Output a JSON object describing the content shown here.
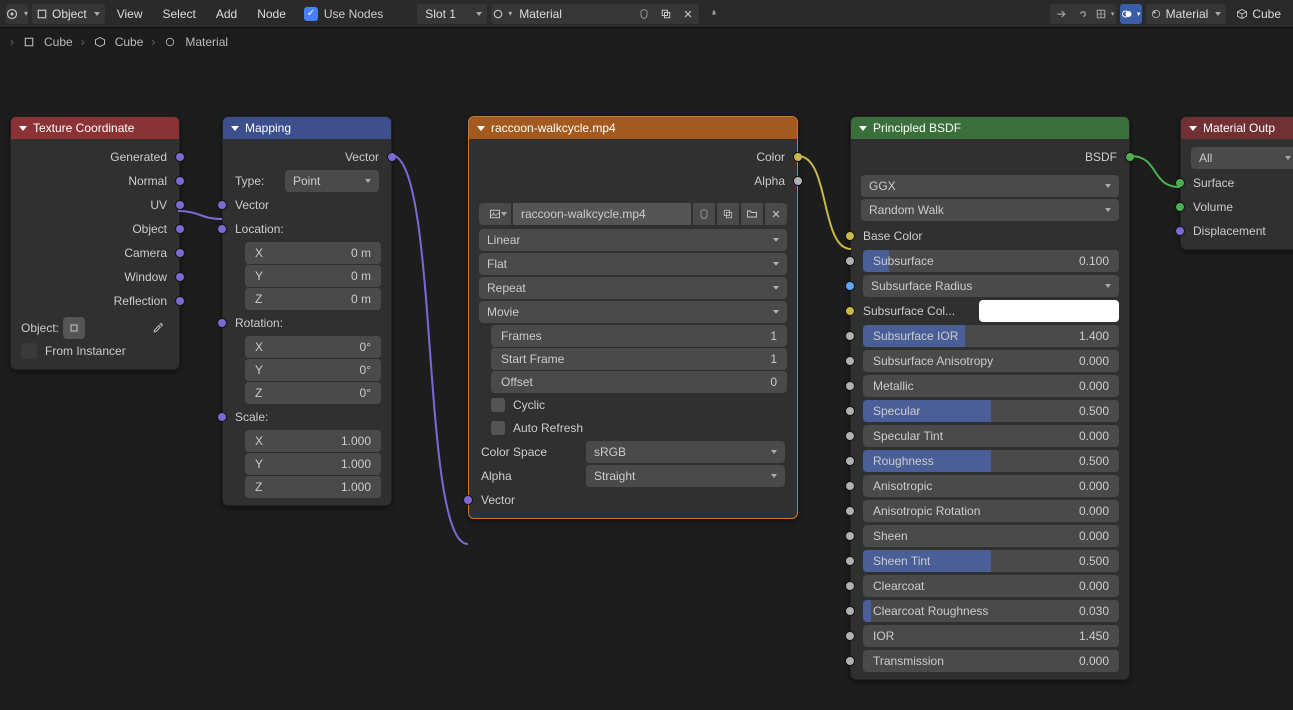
{
  "header": {
    "type_selector": "Object",
    "menu": [
      "View",
      "Select",
      "Add",
      "Node"
    ],
    "use_nodes_label": "Use Nodes",
    "slot": "Slot 1",
    "material_name": "Material",
    "right_material": "Material",
    "object_name": "Cube"
  },
  "breadcrumb": {
    "items": [
      "Cube",
      "Cube",
      "Material"
    ]
  },
  "nodes": {
    "texcoord": {
      "title": "Texture Coordinate",
      "outputs": [
        "Generated",
        "Normal",
        "UV",
        "Object",
        "Camera",
        "Window",
        "Reflection"
      ],
      "object_label": "Object:",
      "from_instancer": "From Instancer"
    },
    "mapping": {
      "title": "Mapping",
      "output_vector": "Vector",
      "type_label": "Type:",
      "type_value": "Point",
      "input_vector": "Vector",
      "location_label": "Location:",
      "loc_x": "0 m",
      "loc_y": "0 m",
      "loc_z": "0 m",
      "rotation_label": "Rotation:",
      "rot_x": "0°",
      "rot_y": "0°",
      "rot_z": "0°",
      "scale_label": "Scale:",
      "sc_x": "1.000",
      "sc_y": "1.000",
      "sc_z": "1.000"
    },
    "image": {
      "title": "raccoon-walkcycle.mp4",
      "out_color": "Color",
      "out_alpha": "Alpha",
      "file": "raccoon-walkcycle.mp4",
      "interp": "Linear",
      "projection": "Flat",
      "extension": "Repeat",
      "source": "Movie",
      "frames_label": "Frames",
      "frames": "1",
      "start_label": "Start Frame",
      "start": "1",
      "offset_label": "Offset",
      "offset": "0",
      "cyclic": "Cyclic",
      "auto_refresh": "Auto Refresh",
      "colorspace_label": "Color Space",
      "colorspace": "sRGB",
      "alpha_label": "Alpha",
      "alpha_mode": "Straight",
      "in_vector": "Vector"
    },
    "bsdf": {
      "title": "Principled BSDF",
      "out_bsdf": "BSDF",
      "distribution": "GGX",
      "subsurface_method": "Random Walk",
      "base_color_label": "Base Color",
      "sliders": [
        {
          "name": "Subsurface",
          "val": "0.100",
          "fill": 10,
          "sock": "grey",
          "widget": "slider"
        },
        {
          "name": "Subsurface Radius",
          "val": "",
          "fill": 0,
          "sock": "blue",
          "widget": "select"
        },
        {
          "name": "Subsurface Col...",
          "val": "",
          "fill": 0,
          "sock": "yellow",
          "widget": "color"
        },
        {
          "name": "Subsurface IOR",
          "val": "1.400",
          "fill": 40,
          "sock": "grey",
          "widget": "slider"
        },
        {
          "name": "Subsurface Anisotropy",
          "val": "0.000",
          "fill": 0,
          "sock": "grey",
          "widget": "slider"
        },
        {
          "name": "Metallic",
          "val": "0.000",
          "fill": 0,
          "sock": "grey",
          "widget": "slider"
        },
        {
          "name": "Specular",
          "val": "0.500",
          "fill": 50,
          "sock": "grey",
          "widget": "slider"
        },
        {
          "name": "Specular Tint",
          "val": "0.000",
          "fill": 0,
          "sock": "grey",
          "widget": "slider"
        },
        {
          "name": "Roughness",
          "val": "0.500",
          "fill": 50,
          "sock": "grey",
          "widget": "slider"
        },
        {
          "name": "Anisotropic",
          "val": "0.000",
          "fill": 0,
          "sock": "grey",
          "widget": "slider"
        },
        {
          "name": "Anisotropic Rotation",
          "val": "0.000",
          "fill": 0,
          "sock": "grey",
          "widget": "slider"
        },
        {
          "name": "Sheen",
          "val": "0.000",
          "fill": 0,
          "sock": "grey",
          "widget": "slider"
        },
        {
          "name": "Sheen Tint",
          "val": "0.500",
          "fill": 50,
          "sock": "grey",
          "widget": "slider"
        },
        {
          "name": "Clearcoat",
          "val": "0.000",
          "fill": 0,
          "sock": "grey",
          "widget": "slider"
        },
        {
          "name": "Clearcoat Roughness",
          "val": "0.030",
          "fill": 3,
          "sock": "grey",
          "widget": "slider"
        },
        {
          "name": "IOR",
          "val": "1.450",
          "fill": 0,
          "sock": "grey",
          "widget": "slider"
        },
        {
          "name": "Transmission",
          "val": "0.000",
          "fill": 0,
          "sock": "grey",
          "widget": "slider"
        }
      ]
    },
    "matout": {
      "title": "Material Outp",
      "target": "All",
      "inputs": [
        "Surface",
        "Volume",
        "Displacement"
      ]
    }
  }
}
